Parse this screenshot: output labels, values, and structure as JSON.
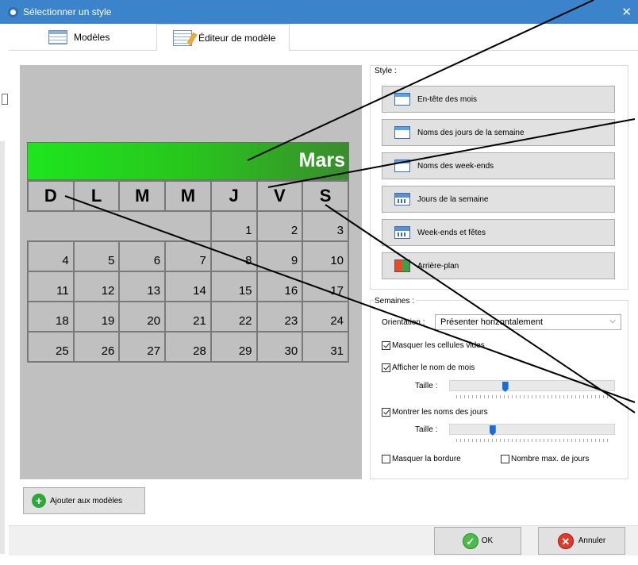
{
  "window": {
    "title": "Sélectionner un style",
    "close_glyph": "✕"
  },
  "tabs": [
    {
      "label": "Modèles",
      "icon": "table-icon"
    },
    {
      "label": "Éditeur de modèle",
      "icon": "edit-template-icon"
    }
  ],
  "calendar": {
    "month": "Mars",
    "day_headers": [
      "D",
      "L",
      "M",
      "M",
      "J",
      "V",
      "S"
    ],
    "weeks": [
      [
        "",
        "",
        "",
        "",
        "1",
        "2",
        "3"
      ],
      [
        "4",
        "5",
        "6",
        "7",
        "8",
        "9",
        "10"
      ],
      [
        "11",
        "12",
        "13",
        "14",
        "15",
        "16",
        "17"
      ],
      [
        "18",
        "19",
        "20",
        "21",
        "22",
        "23",
        "24"
      ],
      [
        "25",
        "26",
        "27",
        "28",
        "29",
        "30",
        "31"
      ]
    ]
  },
  "style_group": {
    "label": "Style :",
    "buttons": [
      {
        "label": "En-tête des mois",
        "icon": "window-icon"
      },
      {
        "label": "Noms des jours de la semaine",
        "icon": "window-icon"
      },
      {
        "label": "Noms des week-ends",
        "icon": "window-icon"
      },
      {
        "label": "Jours de la semaine",
        "icon": "calendar-icon"
      },
      {
        "label": "Week-ends et fêtes",
        "icon": "calendar-icon"
      },
      {
        "label": "Arrière-plan",
        "icon": "background-icon"
      }
    ]
  },
  "weeks_group": {
    "label": "Semaines :",
    "orientation_label": "Orientation :",
    "orientation_value": "Présenter horizontalement",
    "hide_empty_cells": {
      "label": "Masquer les cellules vides",
      "checked": true
    },
    "show_month_name": {
      "label": "Afficher le nom de mois",
      "checked": true
    },
    "month_size_label": "Taille :",
    "month_size_fraction": 0.33,
    "show_day_names": {
      "label": "Montrer les noms des jours",
      "checked": true
    },
    "day_size_label": "Taille :",
    "day_size_fraction": 0.25,
    "hide_border": {
      "label": "Masquer la bordure",
      "checked": false
    },
    "max_days": {
      "label": "Nombre max. de jours",
      "checked": false
    }
  },
  "add_button": {
    "label": "Ajouter aux modèles",
    "icon": "plus-icon"
  },
  "footer": {
    "ok_label": "OK",
    "cancel_label": "Annuler"
  },
  "colors": {
    "titlebar": "#3b84cc",
    "month_bar_start": "#1ee61e",
    "month_bar_end": "#3a8c2e",
    "preview_bg": "#c0c0c0"
  }
}
